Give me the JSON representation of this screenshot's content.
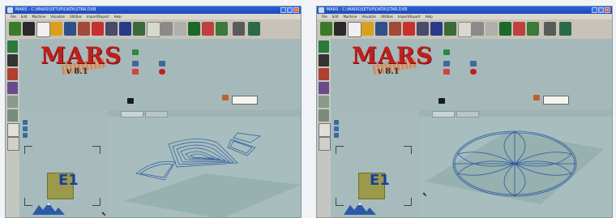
{
  "window": {
    "title": "MARS - C:\\MARS\\SETUP\\DATA\\STAR.DXB",
    "buttons": [
      "_",
      "□",
      "×"
    ]
  },
  "menu": [
    "File",
    "Edit",
    "Machine",
    "Visualize",
    "Utilities",
    "Import/Export",
    "Help"
  ],
  "logo": {
    "name": "MARS",
    "version": "v 8.1"
  },
  "viewport_label": "E1",
  "colors": {
    "titlebar": "#2158d0",
    "logo": "#c0201c",
    "background": "#a9bcbd"
  }
}
